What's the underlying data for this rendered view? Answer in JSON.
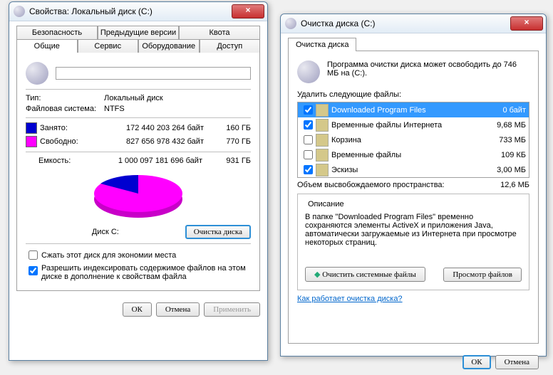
{
  "w1": {
    "title": "Свойства: Локальный диск (C:)",
    "tabsTop": [
      "Безопасность",
      "Предыдущие версии",
      "Квота"
    ],
    "tabsBot": [
      "Общие",
      "Сервис",
      "Оборудование",
      "Доступ"
    ],
    "label": "",
    "typeL": "Тип:",
    "type": "Локальный диск",
    "fsL": "Файловая система:",
    "fs": "NTFS",
    "usedL": "Занято:",
    "usedB": "172 440 203 264 байт",
    "usedG": "160 ГБ",
    "freeL": "Свободно:",
    "freeB": "827 656 978 432 байт",
    "freeG": "770 ГБ",
    "capL": "Емкость:",
    "capB": "1 000 097 181 696 байт",
    "capG": "931 ГБ",
    "diskLbl": "Диск C:",
    "cleanup": "Очистка диска",
    "compress": "Сжать этот диск для экономии места",
    "index": "Разрешить индексировать содержимое файлов на этом диске в дополнение к свойствам файла",
    "ok": "ОК",
    "cancel": "Отмена",
    "apply": "Применить"
  },
  "w2": {
    "title": "Очистка диска  (C:)",
    "tab": "Очистка диска",
    "summary": "Программа очистки диска может освободить до 746 МБ на  (C:).",
    "delHdr": "Удалить следующие файлы:",
    "items": [
      {
        "c": true,
        "n": "Downloaded Program Files",
        "s": "0 байт",
        "sel": true
      },
      {
        "c": true,
        "n": "Временные файлы Интернета",
        "s": "9,68 МБ"
      },
      {
        "c": false,
        "n": "Корзина",
        "s": "733 МБ"
      },
      {
        "c": false,
        "n": "Временные файлы",
        "s": "109 КБ"
      },
      {
        "c": true,
        "n": "Эскизы",
        "s": "3,00 МБ"
      }
    ],
    "freedL": "Объем высвобождаемого пространства:",
    "freed": "12,6 МБ",
    "descHdr": "Описание",
    "desc": "В папке \"Downloaded Program Files\" временно сохраняются элементы ActiveX и приложения Java, автоматически загружаемые из Интернета при просмотре некоторых страниц.",
    "cleanSys": "Очистить системные файлы",
    "view": "Просмотр файлов",
    "how": "Как работает очистка диска?",
    "ok": "ОК",
    "cancel": "Отмена"
  },
  "chart_data": {
    "type": "pie",
    "title": "Диск C:",
    "series": [
      {
        "name": "Занято",
        "value": 160,
        "color": "#0000d0"
      },
      {
        "name": "Свободно",
        "value": 770,
        "color": "#ff00ff"
      }
    ],
    "unit": "ГБ"
  }
}
